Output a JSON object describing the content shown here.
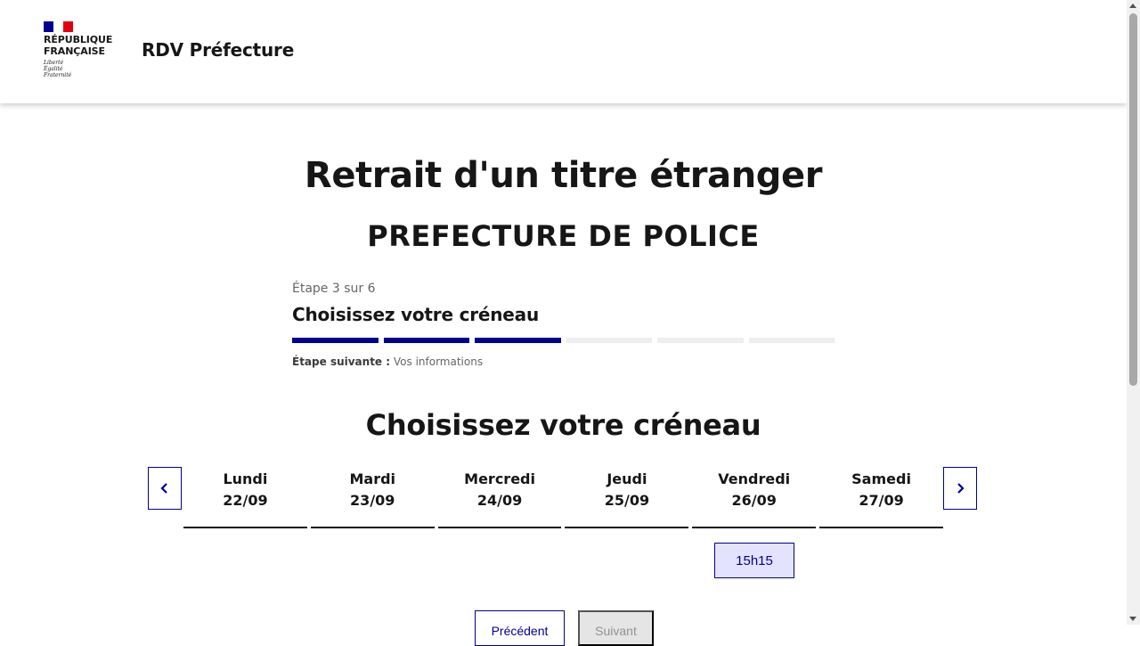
{
  "header": {
    "republic_name": "République\nFrançaise",
    "motto": "Liberté\nÉgalité\nFraternité",
    "service_title": "RDV Préfecture"
  },
  "main": {
    "page_title": "Retrait d'un titre étranger",
    "prefecture": "PREFECTURE DE POLICE"
  },
  "stepper": {
    "state": "Étape 3 sur 6",
    "current_step": 3,
    "total_steps": 6,
    "title": "Choisissez votre créneau",
    "next_label": "Étape suivante :",
    "next_value": "Vos informations"
  },
  "calendar": {
    "title": "Choisissez votre créneau",
    "days": [
      {
        "name": "Lundi",
        "date": "22/09"
      },
      {
        "name": "Mardi",
        "date": "23/09"
      },
      {
        "name": "Mercredi",
        "date": "24/09"
      },
      {
        "name": "Jeudi",
        "date": "25/09"
      },
      {
        "name": "Vendredi",
        "date": "26/09"
      },
      {
        "name": "Samedi",
        "date": "27/09"
      }
    ],
    "slots": [
      {
        "day": "Vendredi",
        "time": "15h15"
      }
    ],
    "prev_icon": "chevron-left-icon",
    "next_icon": "chevron-right-icon"
  },
  "actions": {
    "previous_label": "Précédent",
    "next_label": "Suivant"
  },
  "colors": {
    "primary": "#000091",
    "slot_background": "#e3e3fd",
    "flag_red": "#e1000f"
  }
}
